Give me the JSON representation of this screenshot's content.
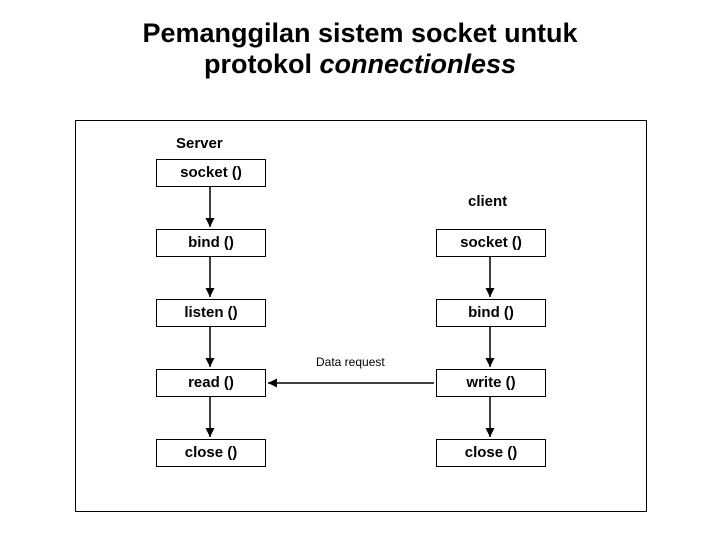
{
  "title": {
    "line1": "Pemanggilan sistem socket untuk",
    "line2_plain": "protokol ",
    "line2_italic": "connectionless"
  },
  "headers": {
    "server": "Server",
    "client": "client"
  },
  "server_steps": {
    "s0": "socket ()",
    "s1": "bind ()",
    "s2": "listen ()",
    "s3": "read ()",
    "s4": "close ()"
  },
  "client_steps": {
    "c0": "socket ()",
    "c1": "bind ()",
    "c2": "write ()",
    "c3": "close ()"
  },
  "edge_label": "Data request"
}
